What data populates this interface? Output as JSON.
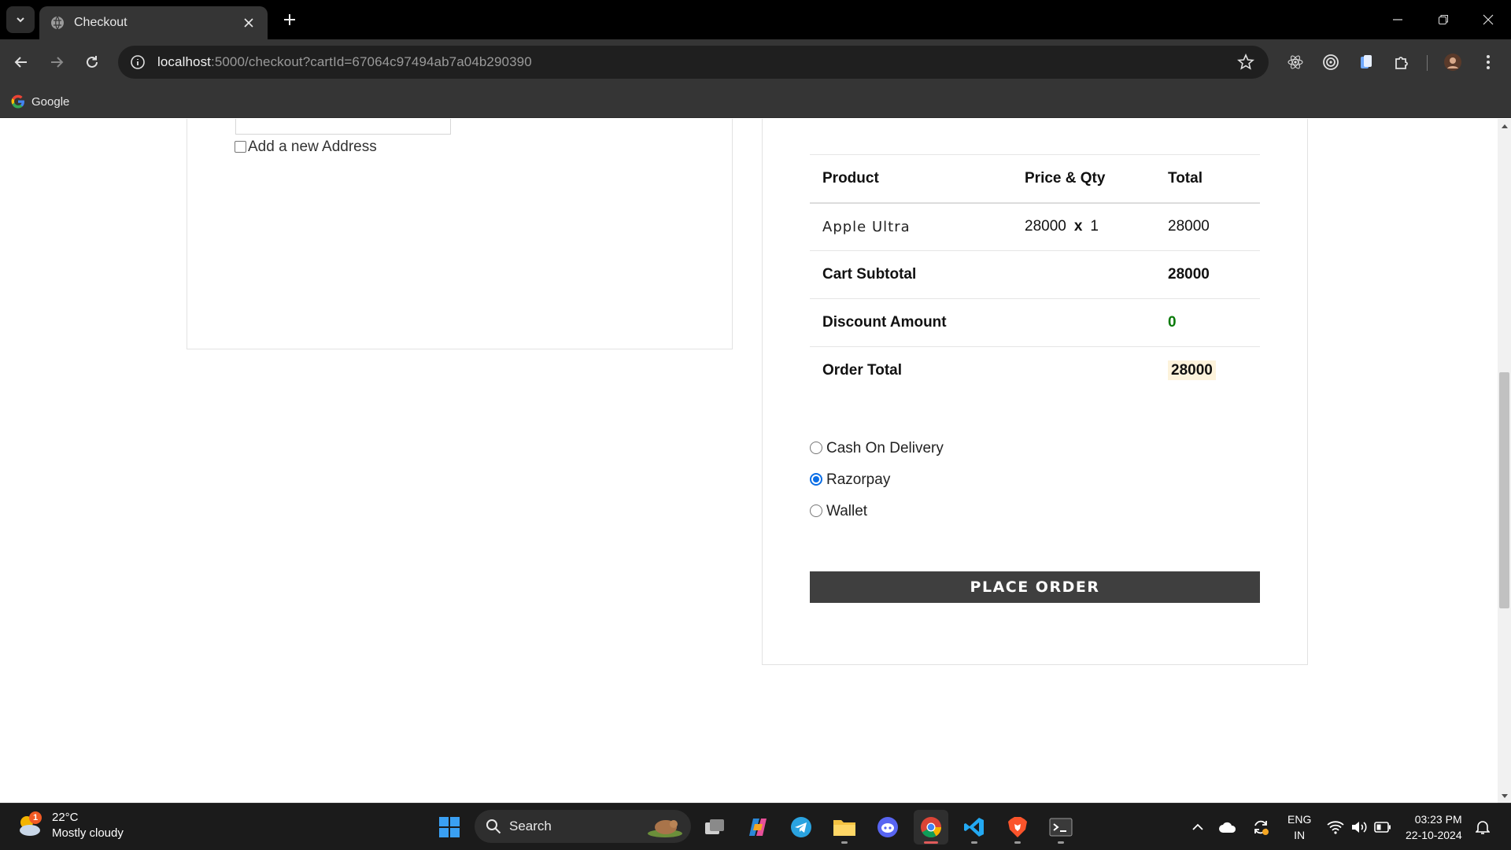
{
  "browser": {
    "tab_title": "Checkout",
    "url_host": "localhost",
    "url_rest": ":5000/checkout?cartId=67064c97494ab7a04b290390",
    "bookmark_google": "Google"
  },
  "left": {
    "new_address_label": "Add a new Address"
  },
  "summary": {
    "headers": [
      "Product",
      "Price & Qty",
      "Total"
    ],
    "item": {
      "name": "Apple Ultra",
      "price": "28000",
      "x": "x",
      "qty": "1",
      "total": "28000"
    },
    "cart_subtotal_label": "Cart Subtotal",
    "cart_subtotal_value": "28000",
    "discount_label": "Discount Amount",
    "discount_value": "0",
    "order_total_label": "Order Total",
    "order_total_value": "28000"
  },
  "payment": {
    "options": [
      "Cash On Delivery",
      "Razorpay",
      "Wallet"
    ],
    "selected": "Razorpay",
    "place_order_label": "PLACE ORDER"
  },
  "taskbar": {
    "weather_temp": "22°C",
    "weather_desc": "Mostly cloudy",
    "weather_badge": "1",
    "search_label": "Search",
    "lang_1": "ENG",
    "lang_2": "IN",
    "time": "03:23 PM",
    "date": "22-10-2024"
  },
  "colors": {
    "accent_radio": "#0b6ee6",
    "discount_green": "#0a7a0a",
    "button_bg": "#3f3f3f",
    "total_highlight": "#fdf3dc"
  }
}
